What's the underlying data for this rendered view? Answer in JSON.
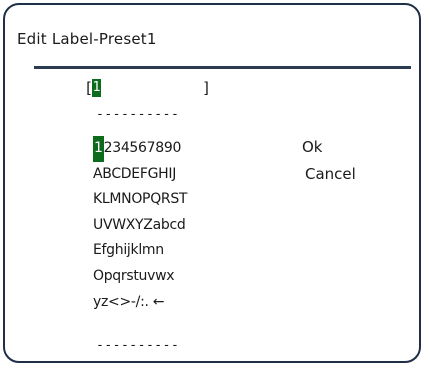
{
  "dialog": {
    "title": "Edit Label-Preset1"
  },
  "field": {
    "left_bracket": "[",
    "value": "1",
    "right_bracket": "]"
  },
  "separator": {
    "top": "----------",
    "bottom": "----------"
  },
  "charset": {
    "selected_char": "1",
    "rows": [
      "234567890",
      "ABCDEFGHIJ",
      "KLMNOPQRST",
      "UVWXYZabcd",
      "Efghijklmn",
      "Opqrstuvwx",
      "yz<>-/:. ←"
    ]
  },
  "buttons": {
    "ok_label": "Ok",
    "cancel_label": "Cancel"
  },
  "colors": {
    "frame": "#1f2f45",
    "highlight": "#0d6b1c"
  }
}
